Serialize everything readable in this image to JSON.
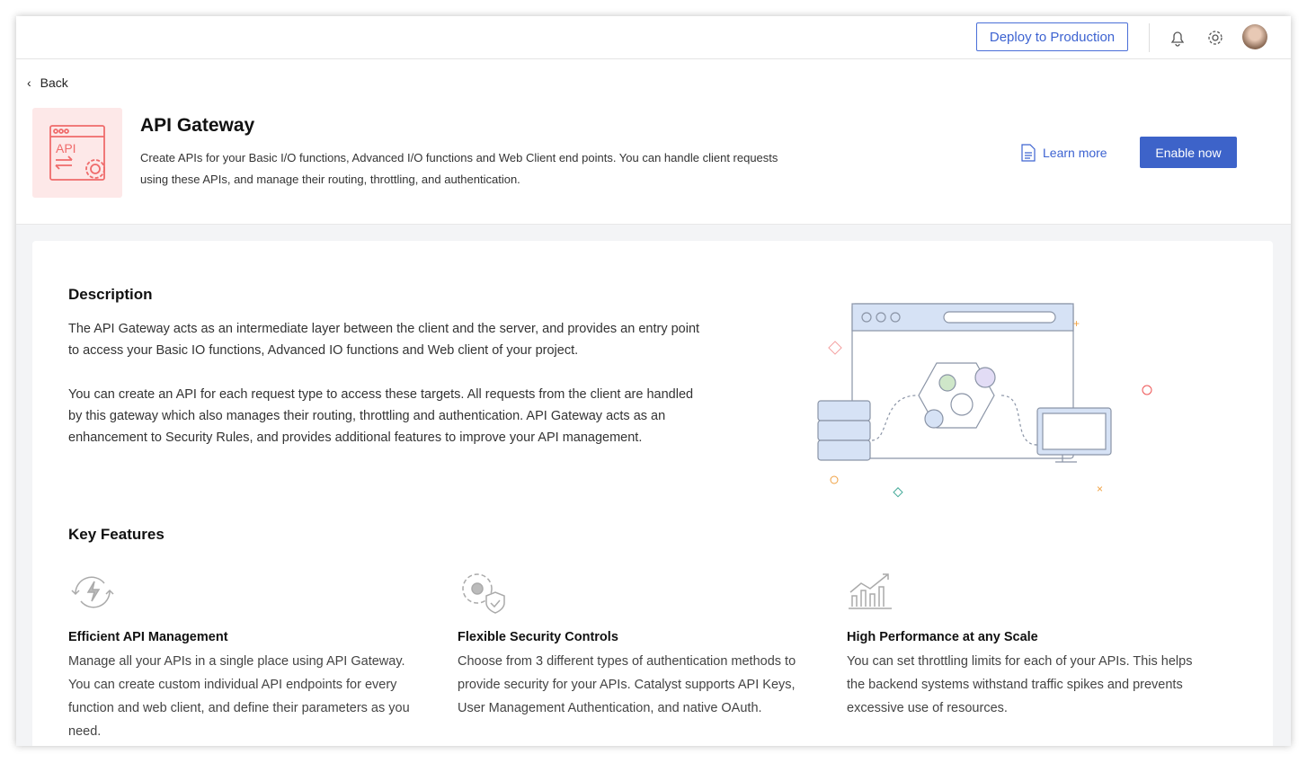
{
  "header": {
    "deploy_label": "Deploy to Production"
  },
  "hero": {
    "back_label": "Back",
    "title": "API Gateway",
    "subtitle": "Create APIs for your Basic I/O functions, Advanced I/O functions and Web Client end points. You can handle client requests using these APIs, and manage their routing, throttling, and authentication.",
    "learn_more": "Learn more",
    "enable_label": "Enable now",
    "logo_text": "API"
  },
  "description": {
    "heading": "Description",
    "paragraphs": [
      "The API Gateway acts as an intermediate layer between the client and the server, and provides an entry point to access your Basic IO functions, Advanced IO functions and Web client of your project.",
      "You can create an API for each request type to access these targets. All requests from the client are handled by this gateway which also manages their routing, throttling and authentication. API Gateway acts as an enhancement to Security Rules, and provides additional features to improve your API management."
    ]
  },
  "features": {
    "heading": "Key Features",
    "items": [
      {
        "title": "Efficient API Management",
        "text": "Manage all your APIs in a single place using API Gateway. You can create custom individual API endpoints for every function and web client, and define their parameters as you need."
      },
      {
        "title": "Flexible Security Controls",
        "text": "Choose from 3 different types of authentication methods to provide security for your APIs. Catalyst supports API Keys, User Management Authentication, and native OAuth."
      },
      {
        "title": "High Performance at any Scale",
        "text": "You can set throttling limits for each of your APIs. This helps the backend systems withstand traffic spikes and prevents excessive use of resources."
      }
    ]
  }
}
